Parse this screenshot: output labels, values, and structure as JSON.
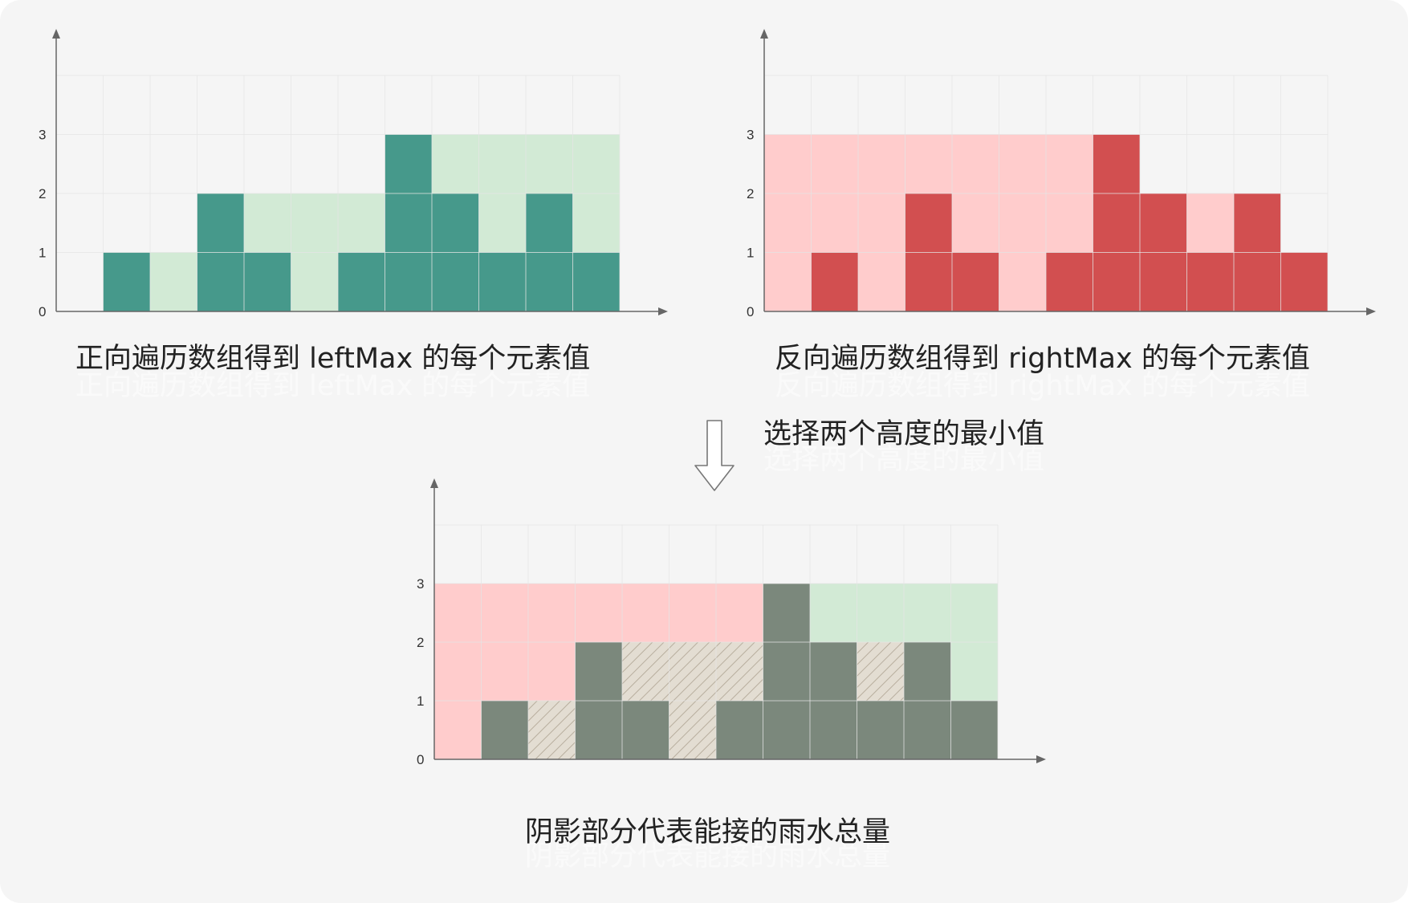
{
  "colors": {
    "background": "#f5f5f5",
    "grid": "#e5e5e5",
    "axis": "#666666",
    "left_bar": "#46998b",
    "left_fill": "#d2ead5",
    "right_bar": "#d24f50",
    "right_fill": "#ffcccc",
    "combined_bar": "#7b887c",
    "water_hatch_bg": "#e3ddd2",
    "water_hatch_line": "#b8ae9e",
    "arrow": "#777777"
  },
  "captions": {
    "left": "正向遍历数组得到 leftMax 的每个元素值",
    "right": "反向遍历数组得到 rightMax 的每个元素值",
    "arrow": "选择两个高度的最小值",
    "bottom": "阴影部分代表能接的雨水总量"
  },
  "chart_data": [
    {
      "type": "bar",
      "series": [
        {
          "values": [
            0,
            1,
            0,
            2,
            1,
            0,
            1,
            3,
            2,
            1,
            2,
            1
          ]
        },
        {
          "values": [
            0,
            1,
            1,
            2,
            2,
            2,
            2,
            3,
            3,
            3,
            3,
            3
          ]
        }
      ],
      "y_ticks": [
        "0",
        "1",
        "2",
        "3"
      ],
      "ylim": [
        0,
        4
      ],
      "grid": true
    },
    {
      "type": "bar",
      "series": [
        {
          "values": [
            0,
            1,
            0,
            2,
            1,
            0,
            1,
            3,
            2,
            1,
            2,
            1
          ]
        },
        {
          "values": [
            3,
            3,
            3,
            3,
            3,
            3,
            3,
            3,
            2,
            2,
            2,
            1
          ]
        }
      ],
      "y_ticks": [
        "0",
        "1",
        "2",
        "3"
      ],
      "ylim": [
        0,
        4
      ],
      "grid": true
    },
    {
      "type": "bar",
      "series": [
        {
          "values": [
            0,
            1,
            0,
            2,
            1,
            0,
            1,
            3,
            2,
            1,
            2,
            1
          ]
        },
        {
          "values": [
            3,
            3,
            3,
            3,
            3,
            3,
            3,
            3,
            2,
            2,
            2,
            1
          ]
        },
        {
          "values": [
            0,
            1,
            1,
            2,
            2,
            2,
            2,
            3,
            3,
            3,
            3,
            3
          ]
        }
      ],
      "y_ticks": [
        "0",
        "1",
        "2",
        "3"
      ],
      "ylim": [
        0,
        4
      ],
      "grid": true
    }
  ]
}
